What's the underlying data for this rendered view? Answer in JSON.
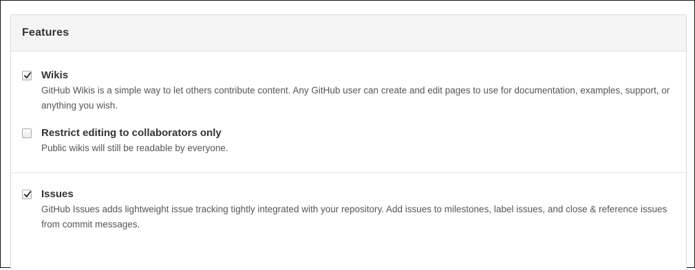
{
  "panel": {
    "title": "Features"
  },
  "options": {
    "wikis": {
      "label": "Wikis",
      "checked": true,
      "note": "GitHub Wikis is a simple way to let others contribute content. Any GitHub user can create and edit pages to use for documentation, examples, support, or anything you wish."
    },
    "restrict": {
      "label": "Restrict editing to collaborators only",
      "checked": false,
      "note": "Public wikis will still be readable by everyone."
    },
    "issues": {
      "label": "Issues",
      "checked": true,
      "note": "GitHub Issues adds lightweight issue tracking tightly integrated with your repository. Add issues to milestones, label issues, and close & reference issues from commit messages."
    }
  },
  "icons": {
    "checkmark": "checkmark-icon"
  }
}
